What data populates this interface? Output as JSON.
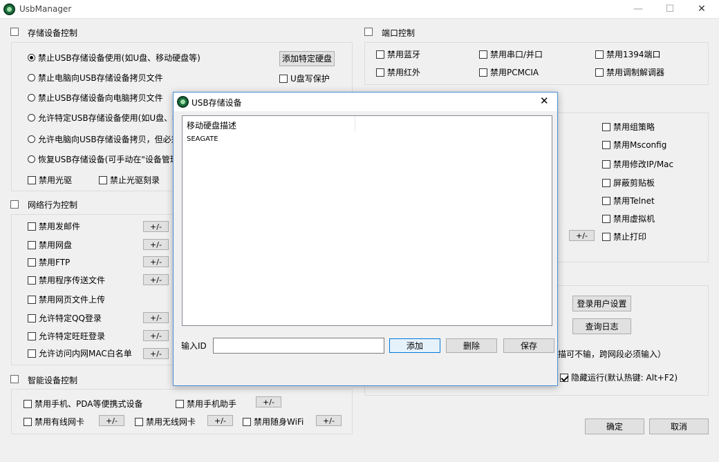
{
  "window": {
    "title": "UsbManager",
    "minimize": "—",
    "maximize": "☐",
    "close": "✕"
  },
  "storage": {
    "title": "存储设备控制",
    "radios": [
      {
        "label": "禁止USB存储设备使用(如U盘、移动硬盘等)",
        "checked": true
      },
      {
        "label": "禁止电脑向USB存储设备拷贝文件",
        "checked": false
      },
      {
        "label": "禁止USB存储设备向电脑拷贝文件",
        "checked": false
      },
      {
        "label": "允许特定USB存储设备使用(如U盘、移",
        "checked": false
      },
      {
        "label": "允许电脑向USB存储设备拷贝，但必须",
        "checked": false
      },
      {
        "label": "恢复USB存储设备(可手动在\"设备管理",
        "checked": false
      }
    ],
    "add_disk_button": "添加特定硬盘",
    "write_protect": "U盘写保护",
    "disable_cdrom": "禁用光驱",
    "disable_burn": "禁止光驱刻录"
  },
  "network": {
    "title": "网络行为控制",
    "items": [
      {
        "label": "禁用发邮件",
        "pm": "+/-"
      },
      {
        "label": "禁用网盘",
        "pm": "+/-"
      },
      {
        "label": "禁用FTP",
        "pm": "+/-"
      },
      {
        "label": "禁用程序传送文件",
        "pm": "+/-"
      },
      {
        "label": "禁用网页文件上传",
        "pm": ""
      },
      {
        "label": "允许特定QQ登录",
        "pm": "+/-"
      },
      {
        "label": "允许特定旺旺登录",
        "pm": "+/-"
      },
      {
        "label": "允许访问内网MAC白名单",
        "pm": "+/-"
      }
    ]
  },
  "smart": {
    "title": "智能设备控制",
    "row1": [
      {
        "label": "禁用手机、PDA等便携式设备"
      },
      {
        "label": "禁用手机助手"
      }
    ],
    "row2": [
      {
        "label": "禁用有线网卡"
      },
      {
        "label": "禁用无线网卡"
      },
      {
        "label": "禁用随身WiFi"
      }
    ],
    "pm": "+/-"
  },
  "ports": {
    "title": "端口控制",
    "items": [
      "禁用蓝牙",
      "禁用串口/并口",
      "禁用1394端口",
      "禁用红外",
      "禁用PCMCIA",
      "禁用调制解调器"
    ]
  },
  "system": {
    "items": [
      "禁用组策略",
      "禁用Msconfig",
      "禁用修改IP/Mac",
      "屏蔽剪贴板",
      "禁用Telnet",
      "禁用虚拟机",
      "禁止打印"
    ],
    "pm": "+/-"
  },
  "other": {
    "login_settings": "登录用户设置",
    "view_log": "查询日志",
    "note": "描可不输，跨网段必须输入）",
    "hide_run": "隐藏运行(默认热键: Alt+F2)"
  },
  "footer": {
    "ok": "确定",
    "cancel": "取消"
  },
  "dialog": {
    "title": "USB存储设备",
    "close": "✕",
    "column": "移动硬盘描述",
    "rows": [
      "SEAGATE"
    ],
    "input_label": "输入ID",
    "input_value": "",
    "add": "添加",
    "delete": "删除",
    "save": "保存"
  }
}
